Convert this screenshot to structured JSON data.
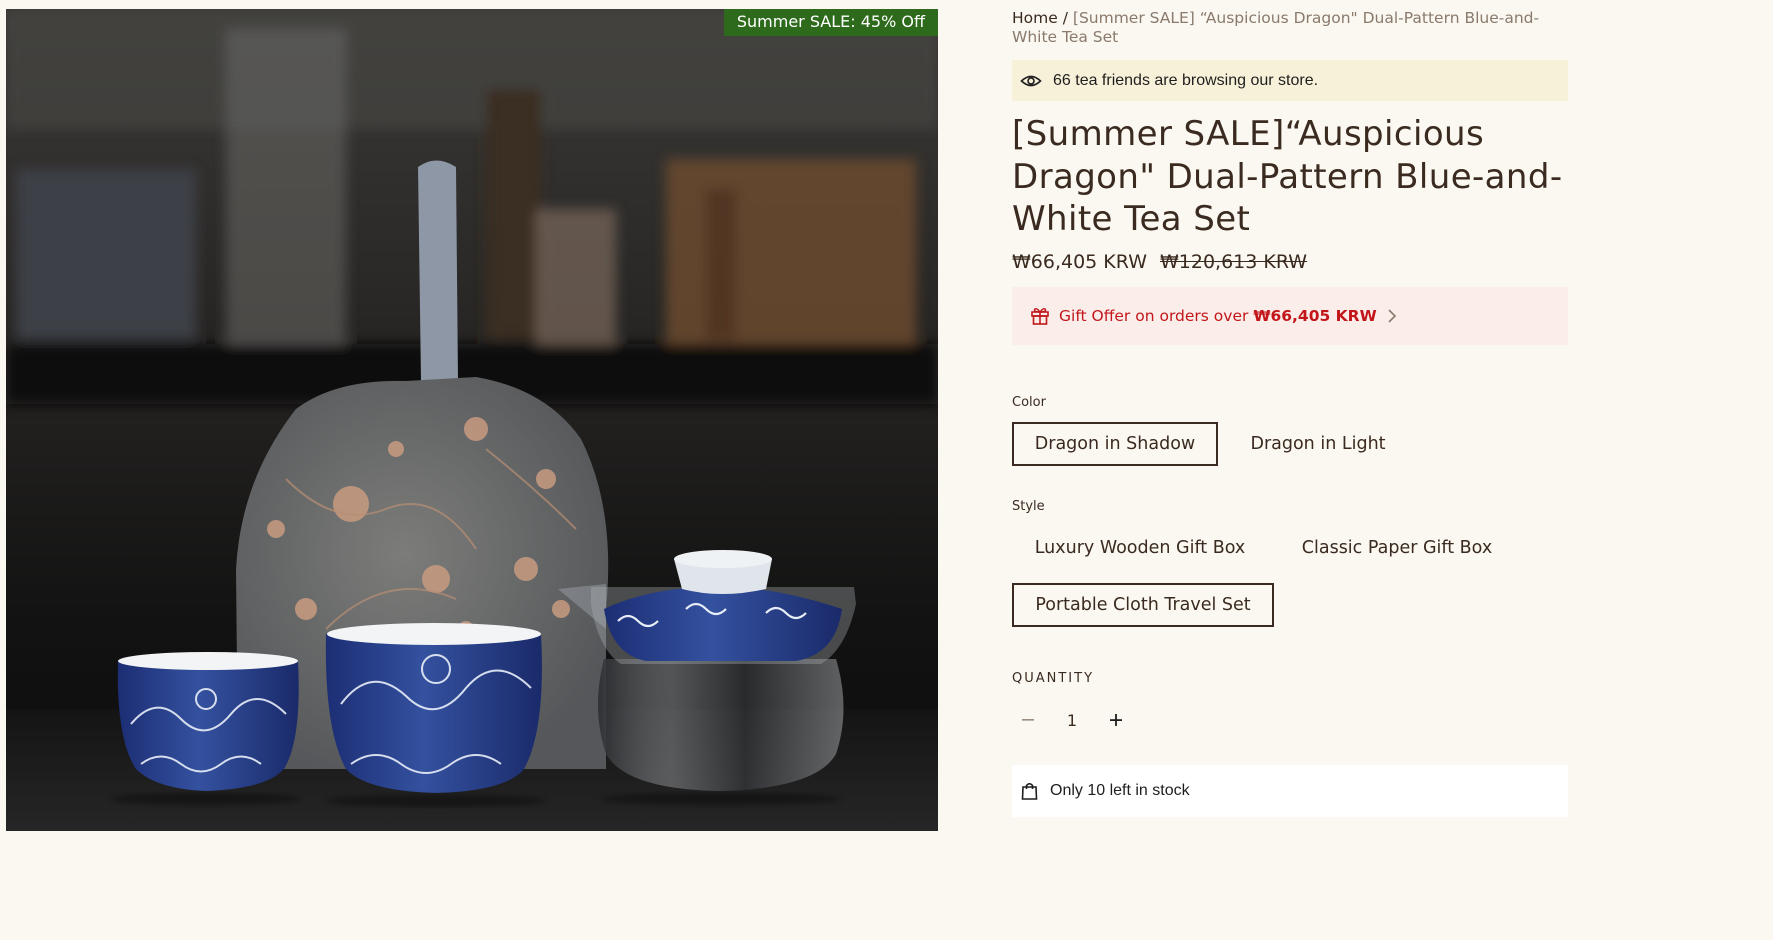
{
  "badge": {
    "text": "Summer SALE: 45% Off",
    "color": "#2d6a1b"
  },
  "breadcrumb": {
    "home": "Home",
    "separator": "/",
    "current": "[Summer SALE] “Auspicious Dragon\" Dual-Pattern Blue-and-White Tea Set"
  },
  "visitors": {
    "icon": "eye-icon",
    "text": "66 tea friends are browsing our store."
  },
  "product": {
    "title": "[Summer SALE]“Auspicious Dragon\" Dual-Pattern Blue-and-White Tea Set",
    "price": "₩66,405 KRW",
    "compare_price": "₩120,613 KRW"
  },
  "gift": {
    "icon": "gift-icon",
    "text": "Gift Offer on orders over",
    "amount": "₩66,405 KRW",
    "color": "#c2161b"
  },
  "color_option": {
    "label": "Color",
    "values": [
      "Dragon in Shadow",
      "Dragon in Light"
    ],
    "selected": "Dragon in Shadow"
  },
  "style_option": {
    "label": "Style",
    "values": [
      "Luxury Wooden Gift Box",
      "Classic Paper Gift Box",
      "Portable Cloth Travel Set"
    ],
    "selected": "Portable Cloth Travel Set"
  },
  "quantity": {
    "label": "QUANTITY",
    "value": "1"
  },
  "stock": {
    "icon": "shopping-bag-icon",
    "text": "Only 10 left in stock"
  }
}
